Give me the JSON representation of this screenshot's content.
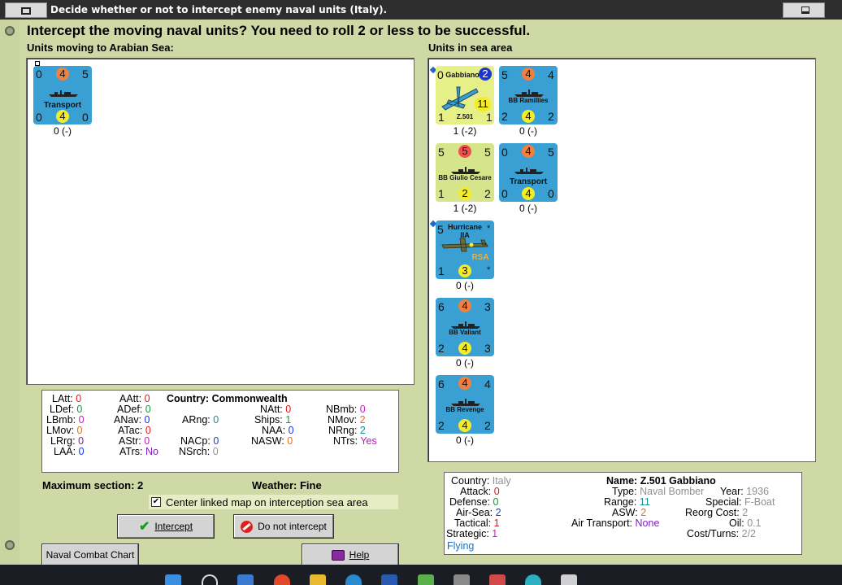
{
  "window": {
    "title": "Decide whether or not to intercept enemy naval units (Italy)."
  },
  "question": "Intercept the moving naval units?  You need to roll 2 or less to be successful.",
  "moving": {
    "label": "Units moving to Arabian Sea:",
    "units": [
      {
        "tl": "0",
        "tc": "4",
        "tr": "5",
        "name": "Transport",
        "bl": "0",
        "bc": "4",
        "br": "0",
        "under": "0 (-)"
      }
    ]
  },
  "sea": {
    "label": "Units in sea area",
    "units": [
      {
        "tl": "0",
        "tc": "2",
        "name": "Gabbiano",
        "big": "11",
        "model": "Z.501",
        "bl": "1",
        "br": "1",
        "under": "1 (-2)"
      },
      {
        "tl": "5",
        "tc": "4",
        "tr": "4",
        "name": "BB Ramillies",
        "bl": "2",
        "bc": "4",
        "br": "2",
        "under": "0 (-)"
      },
      {
        "tl": "5",
        "tc": "5",
        "tr": "5",
        "name": "BB Giulio Cesare",
        "bl": "1",
        "bc": "2",
        "br": "2",
        "under": "1 (-2)"
      },
      {
        "tl": "0",
        "tc": "4",
        "tr": "5",
        "name": "Transport",
        "bl": "0",
        "bc": "4",
        "br": "0",
        "under": "0 (-)"
      },
      {
        "tl": "5",
        "name": "Hurricane IIA",
        "star": "*",
        "tag": "RSA",
        "bl": "1",
        "bc": "3",
        "br": "*",
        "under": "0 (-)"
      },
      {
        "tl": "6",
        "tc": "4",
        "tr": "3",
        "name": "BB Valiant",
        "bl": "2",
        "bc": "4",
        "br": "3",
        "under": "0 (-)"
      },
      {
        "tl": "6",
        "tc": "4",
        "tr": "4",
        "name": "BB Revenge",
        "bl": "2",
        "bc": "4",
        "br": "2",
        "under": "0 (-)"
      }
    ]
  },
  "stats": {
    "latt": {
      "k": "LAtt:",
      "v": "0"
    },
    "ldef": {
      "k": "LDef:",
      "v": "0"
    },
    "lbmb": {
      "k": "LBmb:",
      "v": "0"
    },
    "lmov": {
      "k": "LMov:",
      "v": "0"
    },
    "lrg": {
      "k": "LRrg:",
      "v": "0"
    },
    "laa": {
      "k": "LAA:",
      "v": "0"
    },
    "aatt": {
      "k": "AAtt:",
      "v": "0"
    },
    "adef": {
      "k": "ADef:",
      "v": "0"
    },
    "anav": {
      "k": "ANav:",
      "v": "0"
    },
    "atac": {
      "k": "ATac:",
      "v": "0"
    },
    "astr": {
      "k": "AStr:",
      "v": "0"
    },
    "atrs": {
      "k": "ATrs:",
      "v": "No"
    },
    "country_label": "Country:",
    "country": "Commonwealth",
    "arng": {
      "k": "ARng:",
      "v": "0"
    },
    "nacp": {
      "k": "NACp:",
      "v": "0"
    },
    "nsrch": {
      "k": "NSrch:",
      "v": "0"
    },
    "natt": {
      "k": "NAtt:",
      "v": "0"
    },
    "ships": {
      "k": "Ships:",
      "v": "1"
    },
    "naa": {
      "k": "NAA:",
      "v": "0"
    },
    "nasw": {
      "k": "NASW:",
      "v": "0"
    },
    "nbmb": {
      "k": "NBmb:",
      "v": "0"
    },
    "nmov": {
      "k": "NMov:",
      "v": "2"
    },
    "nrng": {
      "k": "NRng:",
      "v": "2"
    },
    "ntrs": {
      "k": "NTrs:",
      "v": "Yes"
    }
  },
  "max_section": "Maximum section: 2",
  "weather": "Weather:  Fine",
  "center_label": "Center linked map on interception sea area",
  "center_checked": true,
  "buttons": {
    "intercept": "Intercept",
    "no_intercept": "Do not intercept",
    "combat_chart": "Naval Combat Chart",
    "help": "Help"
  },
  "detail": {
    "country": {
      "k": "Country:",
      "v": "Italy"
    },
    "attack": {
      "k": "Attack:",
      "v": "0"
    },
    "defense": {
      "k": "Defense:",
      "v": "0"
    },
    "airsea": {
      "k": "Air-Sea:",
      "v": "2"
    },
    "tactical": {
      "k": "Tactical:",
      "v": "1"
    },
    "strategic": {
      "k": "Strategic:",
      "v": "1"
    },
    "flying": "Flying",
    "name_k": "Name:",
    "name_v": "Z.501 Gabbiano",
    "type": {
      "k": "Type:",
      "v": "Naval Bomber"
    },
    "year": {
      "k": "Year:",
      "v": "1936"
    },
    "range": {
      "k": "Range:",
      "v": "11"
    },
    "special": {
      "k": "Special:",
      "v": "F-Boat"
    },
    "asw": {
      "k": "ASW:",
      "v": "2"
    },
    "reorg": {
      "k": "Reorg Cost:",
      "v": "2"
    },
    "airtrans": {
      "k": "Air Transport:",
      "v": "None"
    },
    "oil": {
      "k": "Oil:",
      "v": "0.1"
    },
    "cost": {
      "k": "Cost/Turns:",
      "v": "2/2"
    }
  },
  "colors": {
    "counter_blue": "#3aa0d4",
    "counter_green": "#d6e58a",
    "panel_bg": "#cfd9a6"
  }
}
